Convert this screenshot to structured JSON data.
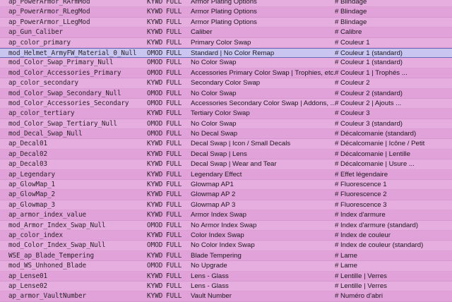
{
  "rows": [
    {
      "id": "ap_PowerArmor_RArmMod",
      "type": "KYWD",
      "flag": "FULL",
      "desc": "Armor Plating Options",
      "trans": "# Blindage"
    },
    {
      "id": "ap_PowerArmor_RLegMod",
      "type": "KYWD",
      "flag": "FULL",
      "desc": "Armor Plating Options",
      "trans": "# Blindage"
    },
    {
      "id": "ap_PowerArmor_LLegMod",
      "type": "KYWD",
      "flag": "FULL",
      "desc": "Armor Plating Options",
      "trans": "# Blindage"
    },
    {
      "id": "ap_Gun_Caliber",
      "type": "KYWD",
      "flag": "FULL",
      "desc": "Caliber",
      "trans": "# Calibre"
    },
    {
      "id": "ap_color_primary",
      "type": "KYWD",
      "flag": "FULL",
      "desc": "Primary Color Swap",
      "trans": "# Couleur 1"
    },
    {
      "id": "mod_Helmet_ArmyFW_Material_0_Null",
      "type": "OMOD",
      "flag": "FULL",
      "desc": "Standard | No Color Remap",
      "trans": "# Couleur 1        (standard)"
    },
    {
      "id": "mod_Color_Swap_Primary_Null",
      "type": "OMOD",
      "flag": "FULL",
      "desc": "No Color Swap",
      "trans": "# Couleur 1        (standard)"
    },
    {
      "id": "mod_Color_Accessories_Primary",
      "type": "OMOD",
      "flag": "FULL",
      "desc": "Accessories Primary Color Swap | Trophies, etc.",
      "trans": "# Couleur 1 | Trophés ..."
    },
    {
      "id": "ap_color_secondary",
      "type": "KYWD",
      "flag": "FULL",
      "desc": "Secondary Color Swap",
      "trans": "# Couleur 2"
    },
    {
      "id": "mod_Color_Swap_Secondary_Null",
      "type": "OMOD",
      "flag": "FULL",
      "desc": "No Color Swap",
      "trans": "# Couleur 2        (standard)"
    },
    {
      "id": "mod_Color_Accessories_Secondary",
      "type": "OMOD",
      "flag": "FULL",
      "desc": "Accessories Secondary Color Swap |  Addons, ...",
      "trans": "# Couleur 2 | Ajouts ..."
    },
    {
      "id": "ap_color_tertiary",
      "type": "KYWD",
      "flag": "FULL",
      "desc": "Tertiary Color Swap",
      "trans": "# Couleur 3"
    },
    {
      "id": "mod_Color_Swap_Tertiary_Null",
      "type": "OMOD",
      "flag": "FULL",
      "desc": "No Color Swap",
      "trans": "# Couleur 3        (standard)"
    },
    {
      "id": "mod_Decal_Swap_Null",
      "type": "OMOD",
      "flag": "FULL",
      "desc": "No Decal Swap",
      "trans": "# Décalcomanie     (standard)"
    },
    {
      "id": "ap_Decal01",
      "type": "KYWD",
      "flag": "FULL",
      "desc": "Decal Swap | Icon / Small Decals",
      "trans": "# Décalcomanie | Icône / Petit"
    },
    {
      "id": "ap_Decal02",
      "type": "KYWD",
      "flag": "FULL",
      "desc": "Decal Swap | Lens",
      "trans": "# Décalcomanie | Lentille"
    },
    {
      "id": "ap_Decal03",
      "type": "KYWD",
      "flag": "FULL",
      "desc": "Decal Swap | Wear and Tear",
      "trans": "# Décalcomanie | Usure ..."
    },
    {
      "id": "ap_Legendary",
      "type": "KYWD",
      "flag": "FULL",
      "desc": "Legendary Effect",
      "trans": "# Effet légendaire"
    },
    {
      "id": "ap_GlowMap_1",
      "type": "KYWD",
      "flag": "FULL",
      "desc": "Glowmap AP1",
      "trans": "# Fluorescence 1"
    },
    {
      "id": "ap_GlowMap_2",
      "type": "KYWD",
      "flag": "FULL",
      "desc": "Glowmap AP 2",
      "trans": "# Fluorescence 2"
    },
    {
      "id": "ap_Glowmap_3",
      "type": "KYWD",
      "flag": "FULL",
      "desc": "Glowmap AP 3",
      "trans": "# Fluorescence 3"
    },
    {
      "id": "ap_armor_index_value",
      "type": "KYWD",
      "flag": "FULL",
      "desc": "Armor Index Swap",
      "trans": "# Index d'armure"
    },
    {
      "id": "mod_Armor_Index_Swap_Null",
      "type": "OMOD",
      "flag": "FULL",
      "desc": "No Armor Index Swap",
      "trans": "# Index d'armure      (standard)"
    },
    {
      "id": "ap_color_index",
      "type": "KYWD",
      "flag": "FULL",
      "desc": "Color Index Swap",
      "trans": "# Index de couleur"
    },
    {
      "id": "mod_Color_Index_Swap_Null",
      "type": "OMOD",
      "flag": "FULL",
      "desc": "No Color Index Swap",
      "trans": "# Index de couleur    (standard)"
    },
    {
      "id": "WSE_ap_Blade_Tempering",
      "type": "KYWD",
      "flag": "FULL",
      "desc": "Blade Tempering",
      "trans": "# Lame"
    },
    {
      "id": "mod_WS_Unhoned_Blade",
      "type": "OMOD",
      "flag": "FULL",
      "desc": "No Upgrade",
      "trans": "# Lame"
    },
    {
      "id": "ap_Lense01",
      "type": "KYWD",
      "flag": "FULL",
      "desc": "Lens - Glass",
      "trans": "# Lentille | Verres"
    },
    {
      "id": "ap_Lense02",
      "type": "KYWD",
      "flag": "FULL",
      "desc": "Lens - Glass",
      "trans": "# Lentille | Verres"
    },
    {
      "id": "ap_armor_VaultNumber",
      "type": "KYWD",
      "flag": "FULL",
      "desc": "Vault Number",
      "trans": "# Numéro d'abri"
    }
  ],
  "selected_row": 5,
  "colors": {
    "row_bg": "#e6addf",
    "row_alt_bg": "#e0a2d8",
    "selected_bg": "#c8c6f1",
    "selected_border": "#6a66b6"
  }
}
